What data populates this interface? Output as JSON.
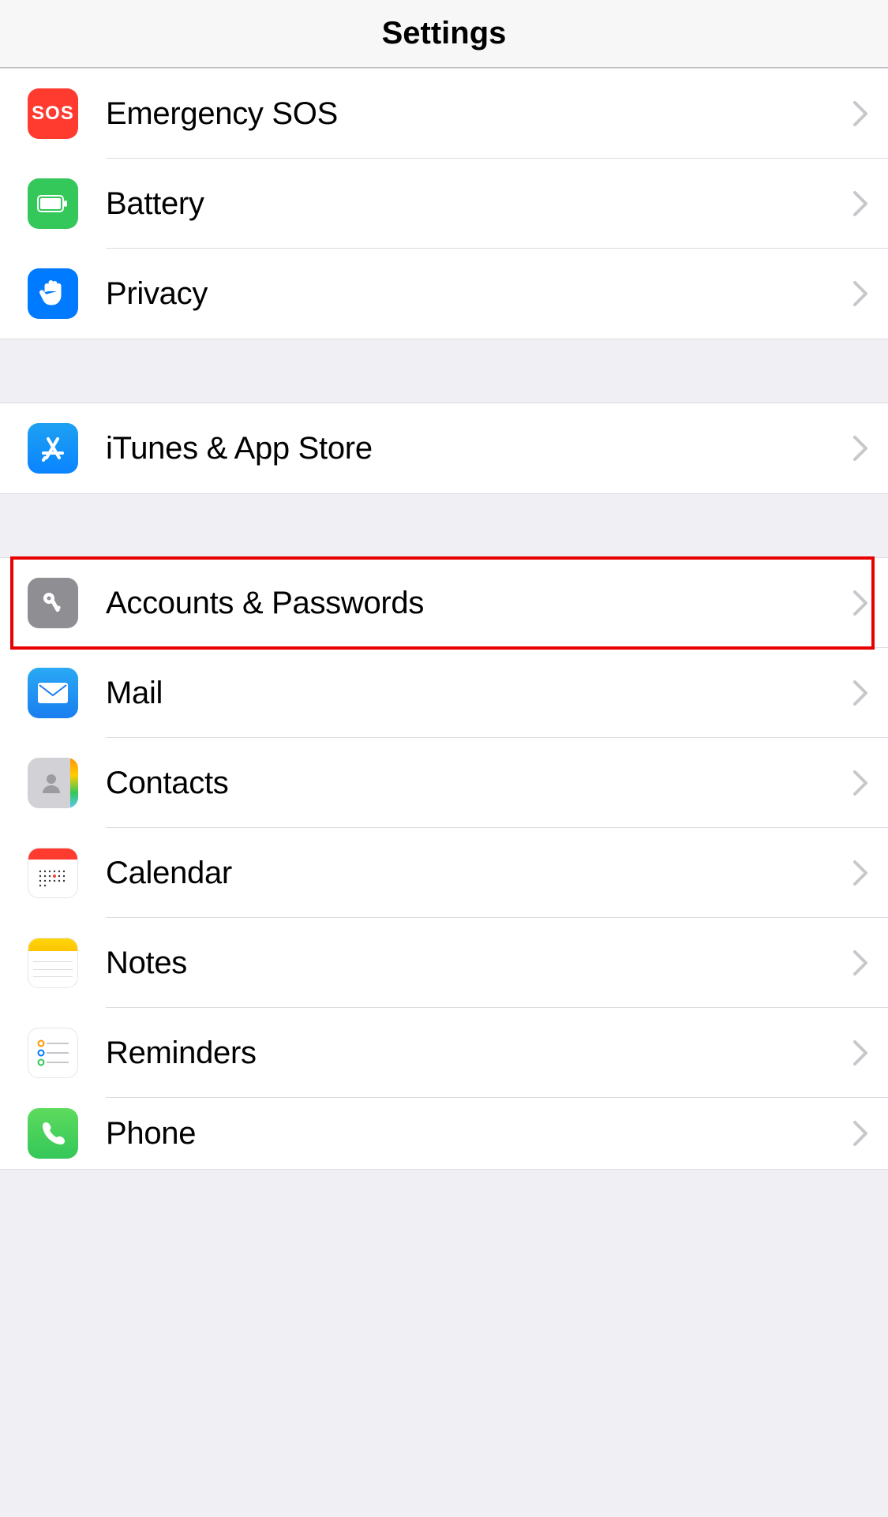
{
  "header": {
    "title": "Settings"
  },
  "sections": [
    {
      "rows": [
        {
          "id": "emergency-sos",
          "label": "Emergency SOS",
          "icon": "sos-icon"
        },
        {
          "id": "battery",
          "label": "Battery",
          "icon": "battery-icon"
        },
        {
          "id": "privacy",
          "label": "Privacy",
          "icon": "hand-icon"
        }
      ]
    },
    {
      "rows": [
        {
          "id": "itunes-appstore",
          "label": "iTunes & App Store",
          "icon": "appstore-icon"
        }
      ]
    },
    {
      "rows": [
        {
          "id": "accounts-passwords",
          "label": "Accounts & Passwords",
          "icon": "key-icon",
          "highlighted": true
        },
        {
          "id": "mail",
          "label": "Mail",
          "icon": "mail-icon"
        },
        {
          "id": "contacts",
          "label": "Contacts",
          "icon": "contacts-icon"
        },
        {
          "id": "calendar",
          "label": "Calendar",
          "icon": "calendar-icon"
        },
        {
          "id": "notes",
          "label": "Notes",
          "icon": "notes-icon"
        },
        {
          "id": "reminders",
          "label": "Reminders",
          "icon": "reminders-icon"
        },
        {
          "id": "phone",
          "label": "Phone",
          "icon": "phone-icon"
        }
      ]
    }
  ]
}
